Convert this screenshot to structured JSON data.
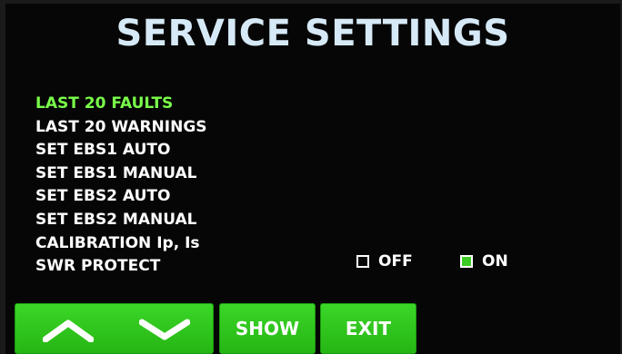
{
  "title": "SERVICE SETTINGS",
  "menu": {
    "items": [
      {
        "label": "LAST 20 FAULTS",
        "selected": true
      },
      {
        "label": "LAST 20 WARNINGS",
        "selected": false
      },
      {
        "label": "SET EBS1 AUTO",
        "selected": false
      },
      {
        "label": "SET EBS1 MANUAL",
        "selected": false
      },
      {
        "label": "SET EBS2 AUTO",
        "selected": false
      },
      {
        "label": "SET EBS2 MANUAL",
        "selected": false
      },
      {
        "label": "CALIBRATION Ip, Is",
        "selected": false
      },
      {
        "label": "SWR PROTECT",
        "selected": false
      }
    ]
  },
  "swr_protect": {
    "off_label": "OFF",
    "on_label": "ON",
    "selected": "ON"
  },
  "buttons": {
    "up_icon": "chevron-up-icon",
    "down_icon": "chevron-down-icon",
    "show_label": "SHOW",
    "exit_label": "EXIT"
  },
  "colors": {
    "selected_item": "#7aff4a",
    "button_green": "#2fc71c",
    "title": "#d6e9f6"
  }
}
